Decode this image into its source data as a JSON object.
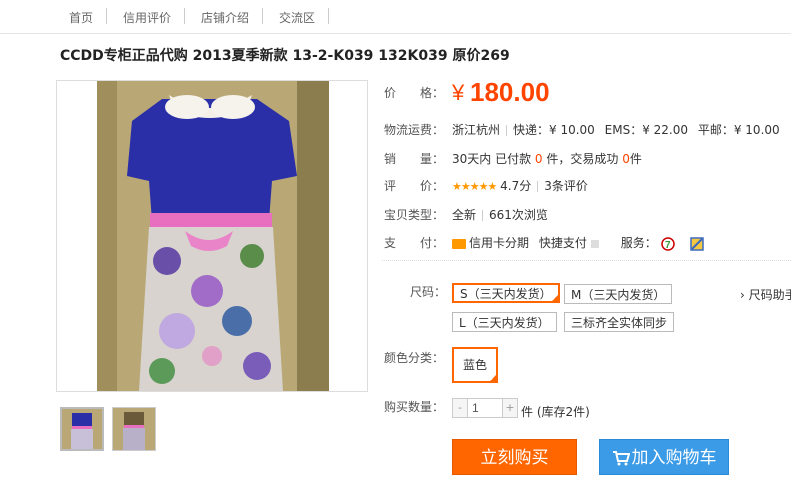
{
  "nav": {
    "items": [
      "首页",
      "信用评价",
      "店铺介绍",
      "交流区"
    ]
  },
  "product": {
    "title": "CCDD专柜正品代购 2013夏季新款 13-2-K039 132K039 原价269"
  },
  "price": {
    "label": "价　　格：",
    "currency": "¥",
    "value": "180.00"
  },
  "shipping": {
    "label": "物流运费：",
    "location": "浙江杭州",
    "express": "快递：¥ 10.00",
    "ems": "EMS：¥ 22.00",
    "mail": "平邮：¥ 10.00"
  },
  "sales": {
    "label": "销　　量：",
    "prefix": "30天内 已付款",
    "paid": "0",
    "mid": "件，交易成功",
    "success": "0",
    "suffix": "件"
  },
  "rating": {
    "label": "评　　价：",
    "stars": "★★★★★",
    "score": "4.7分",
    "reviews": "3条评价"
  },
  "condition": {
    "label": "宝贝类型：",
    "type": "全新",
    "views": "661次浏览"
  },
  "payment": {
    "label": "支　　付：",
    "credit": "信用卡分期",
    "quick": "快捷支付",
    "service_label": "服务："
  },
  "sku": {
    "size_label": "尺码：",
    "sizes": [
      "S（三天内发货）",
      "M（三天内发货）",
      "L（三天内发货）",
      "三标齐全实体同步"
    ],
    "size_helper": "› 尺码助手",
    "color_label": "颜色分类：",
    "color": "蓝色",
    "qty_label": "购买数量：",
    "qty_minus": "-",
    "qty_plus": "+",
    "qty_value": "1",
    "stock": "件 (库存2件)"
  },
  "actions": {
    "buy_now": "立刻购买",
    "add_cart": "加入购物车"
  },
  "colors": {
    "accent": "#ff4400",
    "buy": "#ff6600",
    "cart": "#3b9be6"
  }
}
